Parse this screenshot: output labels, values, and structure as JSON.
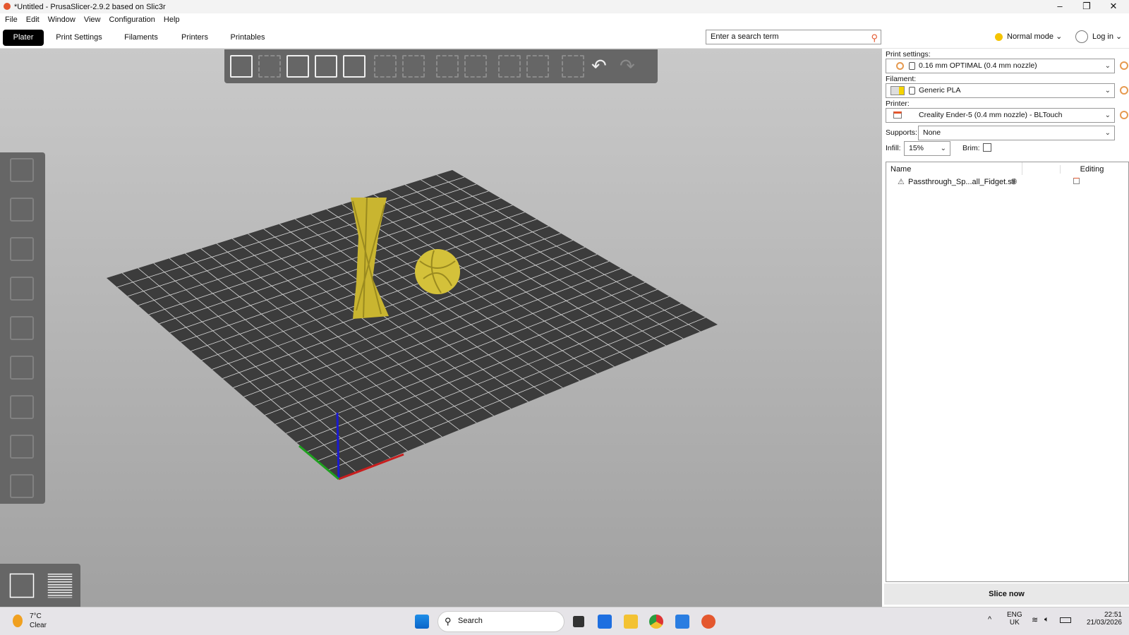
{
  "window": {
    "title": "*Untitled - PrusaSlicer-2.9.2 based on Slic3r",
    "minimize": "–",
    "maximize": "❐",
    "close": "✕"
  },
  "menu": [
    "File",
    "Edit",
    "Window",
    "View",
    "Configuration",
    "Help"
  ],
  "tabs": [
    {
      "label": "Plater",
      "active": true
    },
    {
      "label": "Print Settings"
    },
    {
      "label": "Filaments"
    },
    {
      "label": "Printers"
    },
    {
      "label": "Printables"
    }
  ],
  "search": {
    "placeholder": "Enter a search term"
  },
  "mode": {
    "label": "Normal mode",
    "color": "#f5c400"
  },
  "login": {
    "label": "Log in"
  },
  "toolbar_icons": [
    "add-icon",
    "delete-icon",
    "delete-all-icon",
    "arrange-icon",
    "arrange-selection-icon",
    "copy-icon",
    "paste-icon",
    "add-instance-icon",
    "remove-instance-icon",
    "split-objects-icon",
    "split-parts-icon",
    "layers-editing-icon",
    "undo-icon",
    "redo-icon"
  ],
  "left_tools": [
    "move-icon",
    "scale-icon",
    "rotate-icon",
    "place-on-face-icon",
    "cut-icon",
    "supports-paint-icon",
    "seam-paint-icon",
    "mmu-paint-icon",
    "measure-icon"
  ],
  "panel": {
    "print_settings": {
      "label": "Print settings:",
      "value": "0.16 mm OPTIMAL (0.4 mm nozzle)"
    },
    "filament": {
      "label": "Filament:",
      "value": "Generic PLA",
      "color": "#f5d400"
    },
    "printer": {
      "label": "Printer:",
      "value": "Creality Ender-5 (0.4 mm nozzle) - BLTouch"
    },
    "supports": {
      "label": "Supports:",
      "value": "None"
    },
    "infill": {
      "label": "Infill:",
      "value": "15%"
    },
    "brim": {
      "label": "Brim:",
      "checked": false
    },
    "list": {
      "col_name": "Name",
      "col_editing": "Editing",
      "items": [
        {
          "name": "Passthrough_Sp...all_Fidget.stl",
          "warning": true
        }
      ]
    },
    "slice": "Slice now"
  },
  "taskbar": {
    "weather_temp": "7°C",
    "weather_desc": "Clear",
    "search": "Search",
    "lang1": "ENG",
    "lang2": "UK",
    "time": "22:51",
    "date": "21/03/2026"
  },
  "colors": {
    "accent": "#e4572e",
    "model": "#d4c13a",
    "bed": "#3c3c3c"
  }
}
